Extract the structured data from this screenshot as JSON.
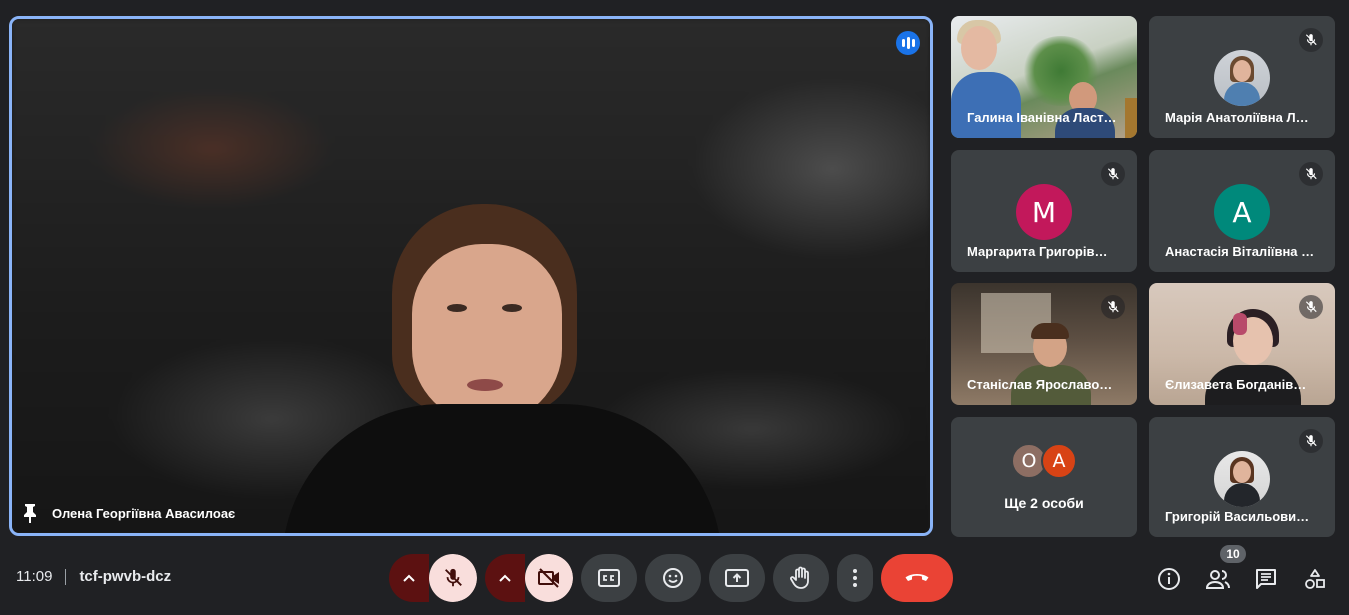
{
  "main": {
    "speaker_name": "Олена Георгіївна Авасилоає"
  },
  "tiles": [
    {
      "name": "Галина Іванівна Ласт…"
    },
    {
      "name": "Марія Анатоліївна Л…"
    },
    {
      "name": "Маргарита Григорів…",
      "initial": "М",
      "color": "#c2185b"
    },
    {
      "name": "Анастасія Віталіївна …",
      "initial": "А",
      "color": "#00897b"
    },
    {
      "name": "Станіслав Ярославо…"
    },
    {
      "name": "Єлизавета Богданів…"
    },
    {
      "more_label": "Ще 2 особи",
      "initials": [
        "О",
        "А"
      ],
      "colors": [
        "#8d6e63",
        "#d84315"
      ]
    },
    {
      "name": "Григорій Васильови…"
    }
  ],
  "meeting": {
    "time": "11:09",
    "code": "tcf-pwvb-dcz",
    "participant_count": "10"
  },
  "colors": {
    "accent": "#8ab4f8",
    "end_call": "#ea4335",
    "muted_bg": "#f9dedc",
    "muted_arrow": "#5c1111"
  }
}
